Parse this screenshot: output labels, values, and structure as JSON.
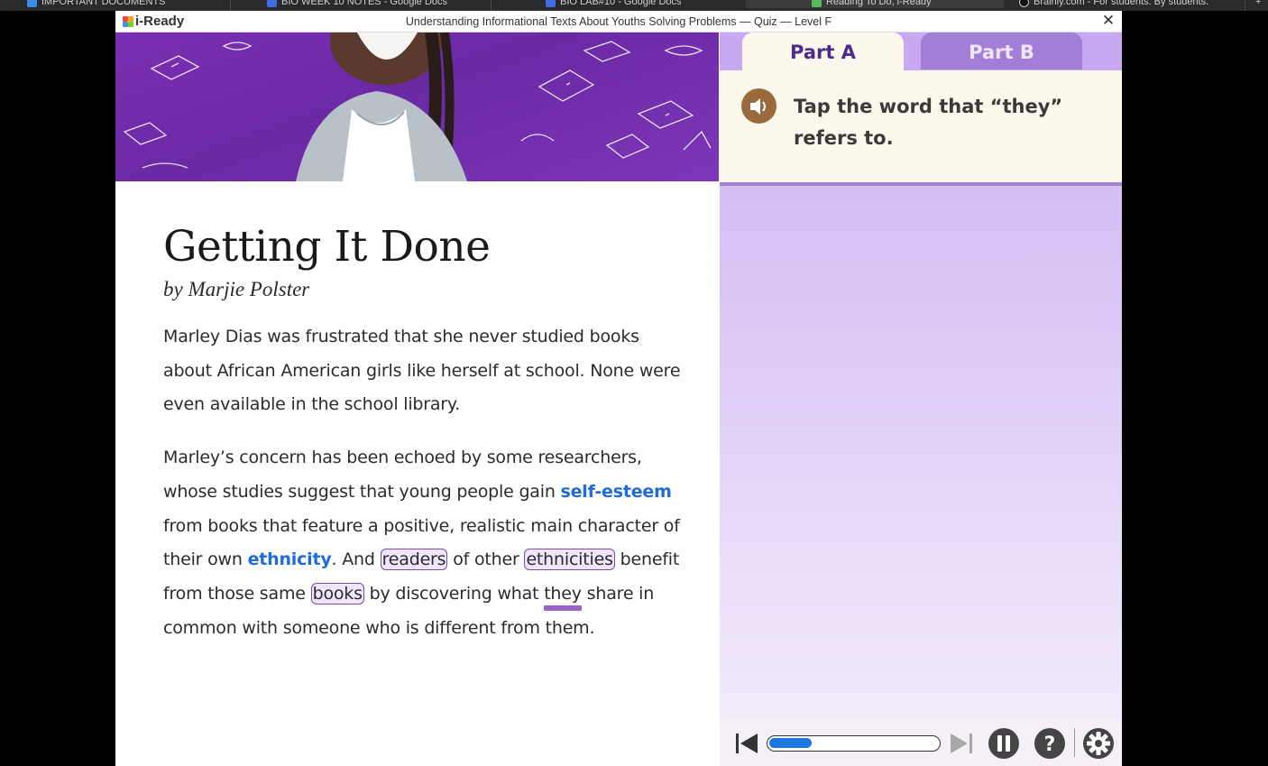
{
  "browser": {
    "tabs": [
      {
        "label": "IMPORTANT DOCUMENTS",
        "icon": "drive-icon",
        "color": "#3a8ee6"
      },
      {
        "label": "BIO WEEK 10 NOTES - Google Docs",
        "icon": "docs-icon",
        "color": "#3d6fe0"
      },
      {
        "label": "BIO LAB#10 - Google Docs",
        "icon": "docs-icon",
        "color": "#3d6fe0"
      },
      {
        "label": "Reading To Do, i-Ready",
        "icon": "iready-icon",
        "color": "#5cb85c"
      },
      {
        "label": "Brainly.com - For students. By students.",
        "icon": "brainly-icon",
        "color": "#111111"
      }
    ],
    "new_tab": "+"
  },
  "window": {
    "brand": "i-Ready",
    "title": "Understanding Informational Texts About Youths Solving Problems — Quiz — Level F",
    "close": "✕"
  },
  "passage": {
    "title": "Getting It Done",
    "byline": "by Marjie Polster",
    "p1": "Marley Dias was frustrated that she never studied books about African American girls like herself at school. None were even available in the school library.",
    "p2": {
      "t1": "Marley’s concern has been echoed by some researchers, whose studies suggest that young people gain ",
      "vocab1": "self-esteem",
      "t2": " from books that feature a positive, realistic main character of their own ",
      "vocab2": "ethnicity",
      "t3": ". And ",
      "choice1": "readers",
      "t4": " of other ",
      "choice2": "ethnicities",
      "t5": " benefit from those same ",
      "choice3": "books",
      "t6": " by discovering what ",
      "target": "they",
      "t7": " share in common with someone who is different from them."
    }
  },
  "question": {
    "tabs": [
      {
        "label": "Part A",
        "selected": true
      },
      {
        "label": "Part B",
        "selected": false
      }
    ],
    "prompt": "Tap the word that “they” refers to."
  },
  "controls": {
    "progress": 0.25,
    "icons": [
      "skip-back-icon",
      "skip-forward-icon",
      "pause-icon",
      "help-icon",
      "settings-icon"
    ]
  },
  "colors": {
    "accent": "#4e2a8c",
    "vocab": "#1f6bdc",
    "progress": "#1f78e0",
    "speaker": "#9a6a3e"
  }
}
